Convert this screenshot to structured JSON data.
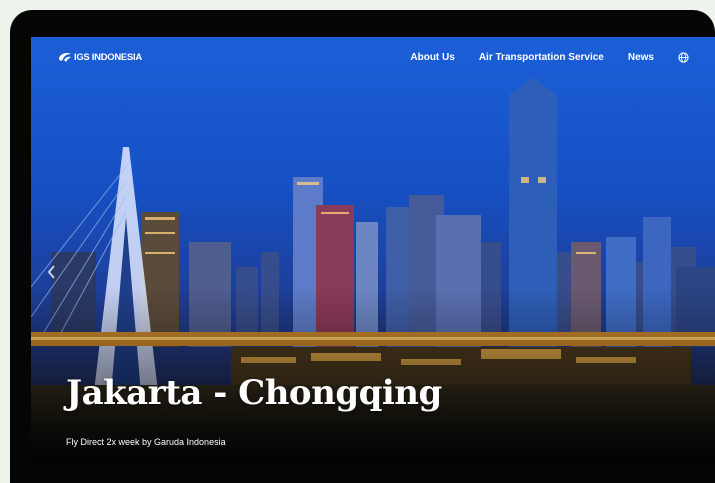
{
  "nav": {
    "logo_text": "IGS INDONESIA",
    "items": [
      {
        "label": "About Us"
      },
      {
        "label": "Air Transportation Service"
      },
      {
        "label": "News"
      }
    ],
    "language_icon": "globe-icon"
  },
  "hero": {
    "title": "Jakarta - Chongqing",
    "subtitle": "Fly Direct 2x week by Garuda Indonesia",
    "prev_icon": "chevron-left-icon",
    "image_description_icon": "chongqing-skyline-photo"
  },
  "colors": {
    "page_background": "#eef3ec",
    "device_frame": "#050505",
    "sky_top": "#1450c8",
    "text": "#ffffff"
  }
}
